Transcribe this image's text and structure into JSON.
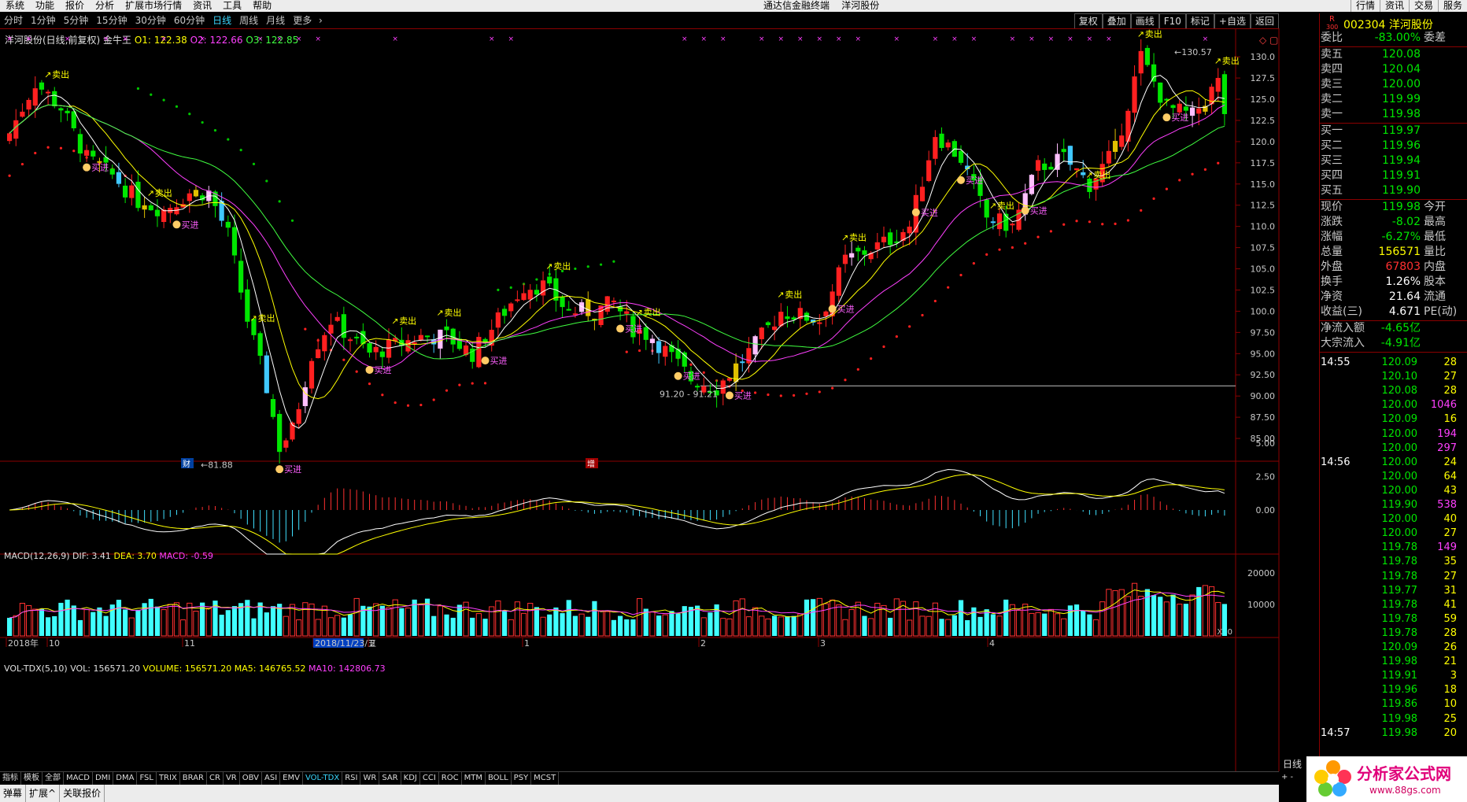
{
  "menu": {
    "items": [
      "系统",
      "功能",
      "报价",
      "分析",
      "扩展市场行情",
      "资讯",
      "工具",
      "帮助"
    ],
    "center_title": "通达信金融终端",
    "center_stock": "洋河股份",
    "right_items": [
      "行情",
      "资讯",
      "交易",
      "服务"
    ]
  },
  "periods": [
    "分时",
    "1分钟",
    "5分钟",
    "15分钟",
    "30分钟",
    "60分钟",
    "日线",
    "周线",
    "月线",
    "更多"
  ],
  "active_period": "日线",
  "tools": [
    "复权",
    "叠加",
    "画线",
    "F10",
    "标记",
    "+自选",
    "返回"
  ],
  "chart_info": {
    "title": "洋河股份(日线,前复权) 金牛王",
    "o1": "O1: 122.38",
    "o2": "O2: 122.66",
    "o3": "O3: 122.85"
  },
  "price_axis": [
    "130.0",
    "127.5",
    "125.0",
    "122.5",
    "120.0",
    "117.5",
    "115.0",
    "112.5",
    "110.0",
    "107.5",
    "105.0",
    "102.5",
    "100.0",
    "97.50",
    "95.00",
    "92.50",
    "90.00",
    "87.50",
    "85.00"
  ],
  "price_range": [
    82.5,
    131.5
  ],
  "annotations": {
    "low": "←81.88",
    "high": "←130.57",
    "range": "91.20 - 91.21",
    "cai": "财",
    "zeng": "增",
    "buy": "买进",
    "sell": "卖出"
  },
  "date_labels": [
    "2018年",
    "10",
    "11",
    "2018/11/23/五",
    "2",
    "1",
    "2",
    "3",
    "4"
  ],
  "macd": {
    "label": "MACD(12,26,9)",
    "dif": "DIF: 3.41",
    "dea": "DEA: 3.70",
    "macd": "MACD: -0.59",
    "axis": [
      "5.00",
      "2.50",
      "0.00"
    ]
  },
  "vol": {
    "label": "VOL-TDX(5,10)",
    "vol": "VOL: 156571.20",
    "volume": "VOLUME: 156571.20",
    "ma5": "MA5: 146765.52",
    "ma10": "MA10: 142806.73",
    "axis": [
      "20000",
      "10000"
    ],
    "unit": "X10"
  },
  "tabs": [
    "指标",
    "模板",
    "全部",
    "MACD",
    "DMI",
    "DMA",
    "FSL",
    "TRIX",
    "BRAR",
    "CR",
    "VR",
    "OBV",
    "ASI",
    "EMV",
    "VOL-TDX",
    "RSI",
    "WR",
    "SAR",
    "KDJ",
    "CCI",
    "ROC",
    "MTM",
    "BOLL",
    "PSY",
    "MCST"
  ],
  "active_tab": "VOL-TDX",
  "bottombar": [
    "弹幕",
    "扩展^",
    "关联报价"
  ],
  "bottom_right": "日线",
  "stock": {
    "code": "002304",
    "name": "洋河股份",
    "badge": "R",
    "badge_sub": "300"
  },
  "orderbook": {
    "weibi": {
      "label": "委比",
      "value": "-83.00%",
      "label2": "委差"
    },
    "asks": [
      {
        "label": "卖五",
        "price": "120.08"
      },
      {
        "label": "卖四",
        "price": "120.04"
      },
      {
        "label": "卖三",
        "price": "120.00"
      },
      {
        "label": "卖二",
        "price": "119.99"
      },
      {
        "label": "卖一",
        "price": "119.98"
      }
    ],
    "bids": [
      {
        "label": "买一",
        "price": "119.97"
      },
      {
        "label": "买二",
        "price": "119.96"
      },
      {
        "label": "买三",
        "price": "119.94"
      },
      {
        "label": "买四",
        "price": "119.91"
      },
      {
        "label": "买五",
        "price": "119.90"
      }
    ]
  },
  "quote": [
    {
      "l1": "现价",
      "v1": "119.98",
      "l2": "今开",
      "c": "#00e600"
    },
    {
      "l1": "涨跌",
      "v1": "-8.02",
      "l2": "最高",
      "c": "#00e600"
    },
    {
      "l1": "涨幅",
      "v1": "-6.27%",
      "l2": "最低",
      "c": "#00e600"
    },
    {
      "l1": "总量",
      "v1": "156571",
      "l2": "量比",
      "c": "#ffff00"
    },
    {
      "l1": "外盘",
      "v1": "67803",
      "l2": "内盘",
      "c": "#ff3030"
    },
    {
      "l1": "换手",
      "v1": "1.26%",
      "l2": "股本",
      "c": "#ffffff"
    },
    {
      "l1": "净资",
      "v1": "21.64",
      "l2": "流通",
      "c": "#ffffff"
    },
    {
      "l1": "收益(三)",
      "v1": "4.671",
      "l2": "PE(动)",
      "c": "#ffffff"
    }
  ],
  "netflow": [
    {
      "label": "净流入额",
      "value": "-4.65亿"
    },
    {
      "label": "大宗流入",
      "value": "-4.91亿"
    }
  ],
  "ticks": [
    {
      "t": "14:55",
      "p": "120.09",
      "v": "28"
    },
    {
      "t": "",
      "p": "120.10",
      "v": "27"
    },
    {
      "t": "",
      "p": "120.08",
      "v": "28"
    },
    {
      "t": "",
      "p": "120.00",
      "v": "1046"
    },
    {
      "t": "",
      "p": "120.09",
      "v": "16"
    },
    {
      "t": "",
      "p": "120.00",
      "v": "194"
    },
    {
      "t": "",
      "p": "120.00",
      "v": "297"
    },
    {
      "t": "14:56",
      "p": "120.00",
      "v": "24"
    },
    {
      "t": "",
      "p": "120.00",
      "v": "64"
    },
    {
      "t": "",
      "p": "120.00",
      "v": "43"
    },
    {
      "t": "",
      "p": "119.90",
      "v": "538"
    },
    {
      "t": "",
      "p": "120.00",
      "v": "40"
    },
    {
      "t": "",
      "p": "120.00",
      "v": "27"
    },
    {
      "t": "",
      "p": "119.78",
      "v": "149"
    },
    {
      "t": "",
      "p": "119.78",
      "v": "35"
    },
    {
      "t": "",
      "p": "119.78",
      "v": "27"
    },
    {
      "t": "",
      "p": "119.77",
      "v": "31"
    },
    {
      "t": "",
      "p": "119.78",
      "v": "41"
    },
    {
      "t": "",
      "p": "119.78",
      "v": "59"
    },
    {
      "t": "",
      "p": "119.78",
      "v": "28"
    },
    {
      "t": "",
      "p": "120.09",
      "v": "26"
    },
    {
      "t": "",
      "p": "119.98",
      "v": "21"
    },
    {
      "t": "",
      "p": "119.91",
      "v": "3"
    },
    {
      "t": "",
      "p": "119.96",
      "v": "18"
    },
    {
      "t": "",
      "p": "119.86",
      "v": "10"
    },
    {
      "t": "",
      "p": "119.98",
      "v": "25"
    },
    {
      "t": "14:57",
      "p": "119.98",
      "v": "20"
    }
  ],
  "watermark": {
    "text": "分析家公式网",
    "url": "www.88gs.com"
  }
}
